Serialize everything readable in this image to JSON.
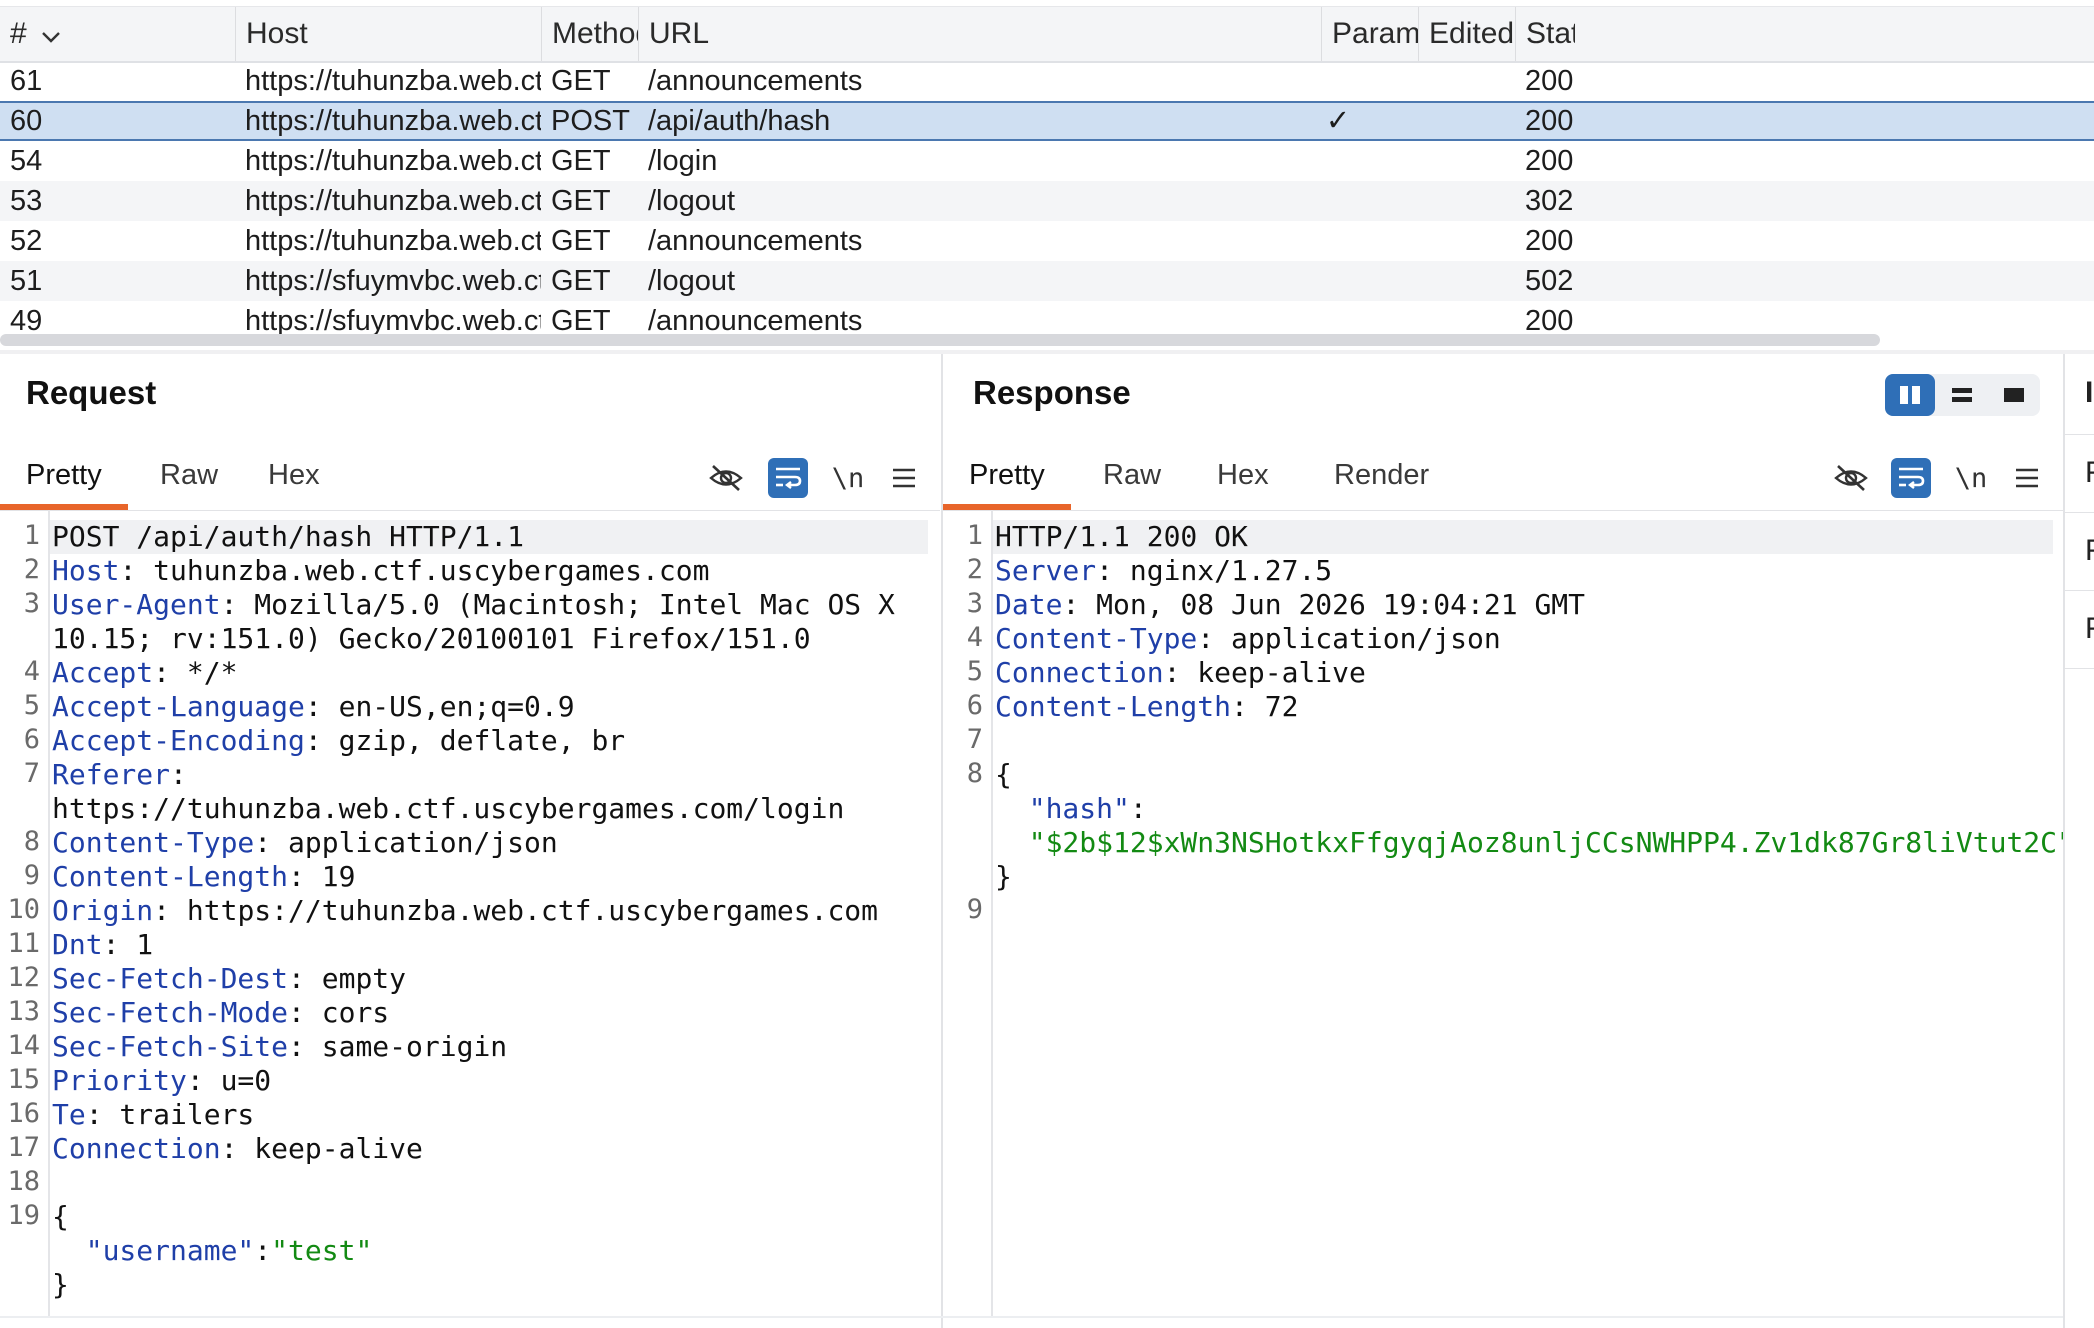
{
  "table": {
    "columns": [
      "#",
      "Host",
      "Method",
      "URL",
      "Params",
      "Edited",
      "Statu"
    ],
    "rows": [
      {
        "id": "61",
        "host": "https://tuhunzba.web.ctf.usc...",
        "method": "GET",
        "url": "/announcements",
        "params": "",
        "status": "200",
        "selected": false
      },
      {
        "id": "60",
        "host": "https://tuhunzba.web.ctf.usc...",
        "method": "POST",
        "url": "/api/auth/hash",
        "params": "✓",
        "status": "200",
        "selected": true
      },
      {
        "id": "54",
        "host": "https://tuhunzba.web.ctf.usc...",
        "method": "GET",
        "url": "/login",
        "params": "",
        "status": "200",
        "selected": false
      },
      {
        "id": "53",
        "host": "https://tuhunzba.web.ctf.usc...",
        "method": "GET",
        "url": "/logout",
        "params": "",
        "status": "302",
        "selected": false
      },
      {
        "id": "52",
        "host": "https://tuhunzba.web.ctf.usc...",
        "method": "GET",
        "url": "/announcements",
        "params": "",
        "status": "200",
        "selected": false
      },
      {
        "id": "51",
        "host": "https://sfuymvbc.web.ctf.usc...",
        "method": "GET",
        "url": "/logout",
        "params": "",
        "status": "502",
        "selected": false
      },
      {
        "id": "49",
        "host": "https://sfuymvbc.web.ctf.usc...",
        "method": "GET",
        "url": "/announcements",
        "params": "",
        "status": "200",
        "selected": false
      }
    ]
  },
  "request": {
    "title": "Request",
    "tabs": [
      "Pretty",
      "Raw",
      "Hex"
    ],
    "active_tab": "Pretty",
    "newline_label": "\\n",
    "line_numbers": [
      "1",
      "2",
      "3",
      "",
      "4",
      "5",
      "6",
      "7",
      "",
      "8",
      "9",
      "10",
      "11",
      "12",
      "13",
      "14",
      "15",
      "16",
      "17",
      "18",
      "19",
      "",
      ""
    ],
    "lines": [
      {
        "k": "",
        "v": "POST /api/auth/hash HTTP/1.1"
      },
      {
        "k": "Host",
        "v": ": tuhunzba.web.ctf.uscybergames.com"
      },
      {
        "k": "User-Agent",
        "v": ": Mozilla/5.0 (Macintosh; Intel Mac OS X"
      },
      {
        "k": "",
        "v": "10.15; rv:151.0) Gecko/20100101 Firefox/151.0"
      },
      {
        "k": "Accept",
        "v": ": */*"
      },
      {
        "k": "Accept-Language",
        "v": ": en-US,en;q=0.9"
      },
      {
        "k": "Accept-Encoding",
        "v": ": gzip, deflate, br"
      },
      {
        "k": "Referer",
        "v": ":"
      },
      {
        "k": "",
        "v": "https://tuhunzba.web.ctf.uscybergames.com/login"
      },
      {
        "k": "Content-Type",
        "v": ": application/json"
      },
      {
        "k": "Content-Length",
        "v": ": 19"
      },
      {
        "k": "Origin",
        "v": ": https://tuhunzba.web.ctf.uscybergames.com"
      },
      {
        "k": "Dnt",
        "v": ": 1"
      },
      {
        "k": "Sec-Fetch-Dest",
        "v": ": empty"
      },
      {
        "k": "Sec-Fetch-Mode",
        "v": ": cors"
      },
      {
        "k": "Sec-Fetch-Site",
        "v": ": same-origin"
      },
      {
        "k": "Priority",
        "v": ": u=0"
      },
      {
        "k": "Te",
        "v": ": trailers"
      },
      {
        "k": "Connection",
        "v": ": keep-alive"
      },
      {
        "k": "",
        "v": ""
      },
      {
        "k": "",
        "v": "{"
      },
      {
        "k": "",
        "v": "  ",
        "jkey": "\"username\"",
        "sep": ":",
        "jval": "\"test\""
      },
      {
        "k": "",
        "v": "}"
      }
    ]
  },
  "response": {
    "title": "Response",
    "tabs": [
      "Pretty",
      "Raw",
      "Hex",
      "Render"
    ],
    "active_tab": "Pretty",
    "newline_label": "\\n",
    "line_numbers": [
      "1",
      "2",
      "3",
      "4",
      "5",
      "6",
      "7",
      "8",
      "",
      "",
      "",
      "9"
    ],
    "lines": [
      {
        "k": "",
        "v": "HTTP/1.1 200 OK"
      },
      {
        "k": "Server",
        "v": ": nginx/1.27.5"
      },
      {
        "k": "Date",
        "v": ": Mon, 08 Jun 2026 19:04:21 GMT"
      },
      {
        "k": "Content-Type",
        "v": ": application/json"
      },
      {
        "k": "Connection",
        "v": ": keep-alive"
      },
      {
        "k": "Content-Length",
        "v": ": 72"
      },
      {
        "k": "",
        "v": ""
      },
      {
        "k": "",
        "v": "{"
      },
      {
        "k": "",
        "v": "  ",
        "jkey": "\"hash\"",
        "sep": ":",
        "jval": ""
      },
      {
        "k": "",
        "v": "  ",
        "jkey": "",
        "sep": "",
        "jval": "\"$2b$12$xWn3NSHotkxFfgyqjAoz8unljCCsNWHPP4.Zv1dk87Gr8liVtut2C\""
      },
      {
        "k": "",
        "v": "}"
      },
      {
        "k": "",
        "v": ""
      }
    ]
  },
  "colors": {
    "accent_tab": "#e8652a",
    "selected_row": "#cfdff2",
    "header_key": "#1f3fa8",
    "json_string": "#138a13",
    "toggle_on": "#2f6fb7"
  },
  "icons": [
    "chevron-down-icon",
    "eye-slash-icon",
    "wrap-lines-icon",
    "menu-icon",
    "split-horizontal-icon",
    "split-vertical-icon",
    "single-pane-icon"
  ]
}
